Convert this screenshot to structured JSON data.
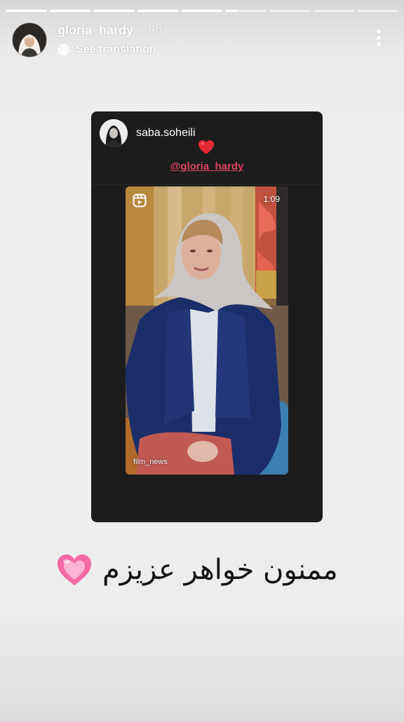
{
  "story": {
    "progress_segments": [
      1,
      1,
      1,
      1,
      1,
      0.3,
      0,
      0,
      0
    ],
    "username": "gloria_hardy",
    "time_ago": "8h",
    "see_translation": "See translation",
    "icons": {
      "translate": "globe-icon",
      "more": "more-vertical-icon"
    }
  },
  "shared_post": {
    "username": "saba.soheili",
    "reaction": "❤️",
    "mention": "@gloria_hardy",
    "reel": {
      "duration": "1:09",
      "watermark": "film_news",
      "icon": "reels-icon"
    }
  },
  "caption": {
    "text": "ممنون خواهر عزیزم",
    "emoji": "💗"
  },
  "colors": {
    "mention": "#e0435e",
    "heart": "#e22b36",
    "pink_heart": "#f36aa5",
    "card_bg": "#1c1c1d"
  }
}
